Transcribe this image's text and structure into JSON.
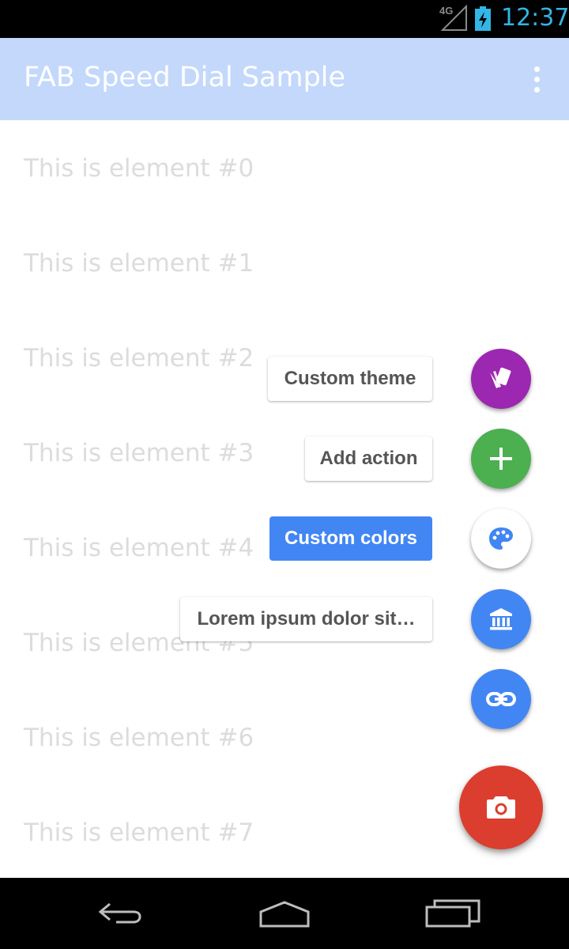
{
  "status_bar": {
    "network": "4G",
    "time": "12:37",
    "icons": [
      "signal-icon",
      "battery-charging-icon"
    ]
  },
  "app_bar": {
    "title": "FAB Speed Dial Sample",
    "menu_icon": "more-vert-icon"
  },
  "list": {
    "items": [
      "This is element #0",
      "This is element #1",
      "This is element #2",
      "This is element #3",
      "This is element #4",
      "This is element #5",
      "This is element #6",
      "This is element #7"
    ]
  },
  "speed_dial": {
    "actions": [
      {
        "label": "Custom theme",
        "icon": "cards-icon",
        "color": "#9c27b0",
        "selected": false
      },
      {
        "label": "Add action",
        "icon": "plus-icon",
        "color": "#4caf50",
        "selected": false
      },
      {
        "label": "Custom colors",
        "icon": "palette-icon",
        "color": "#ffffff",
        "selected": true
      },
      {
        "label": "Lorem ipsum dolor sit…",
        "icon": "bank-icon",
        "color": "#4286f4",
        "selected": false
      },
      {
        "label": "",
        "icon": "link-icon",
        "color": "#4286f4",
        "selected": false
      }
    ],
    "main_fab": {
      "icon": "camera-icon",
      "color": "#db3e2e"
    },
    "selected_label_color": "#4286f4"
  },
  "nav_bar": {
    "icons": [
      "back-icon",
      "home-icon",
      "recents-icon"
    ]
  }
}
